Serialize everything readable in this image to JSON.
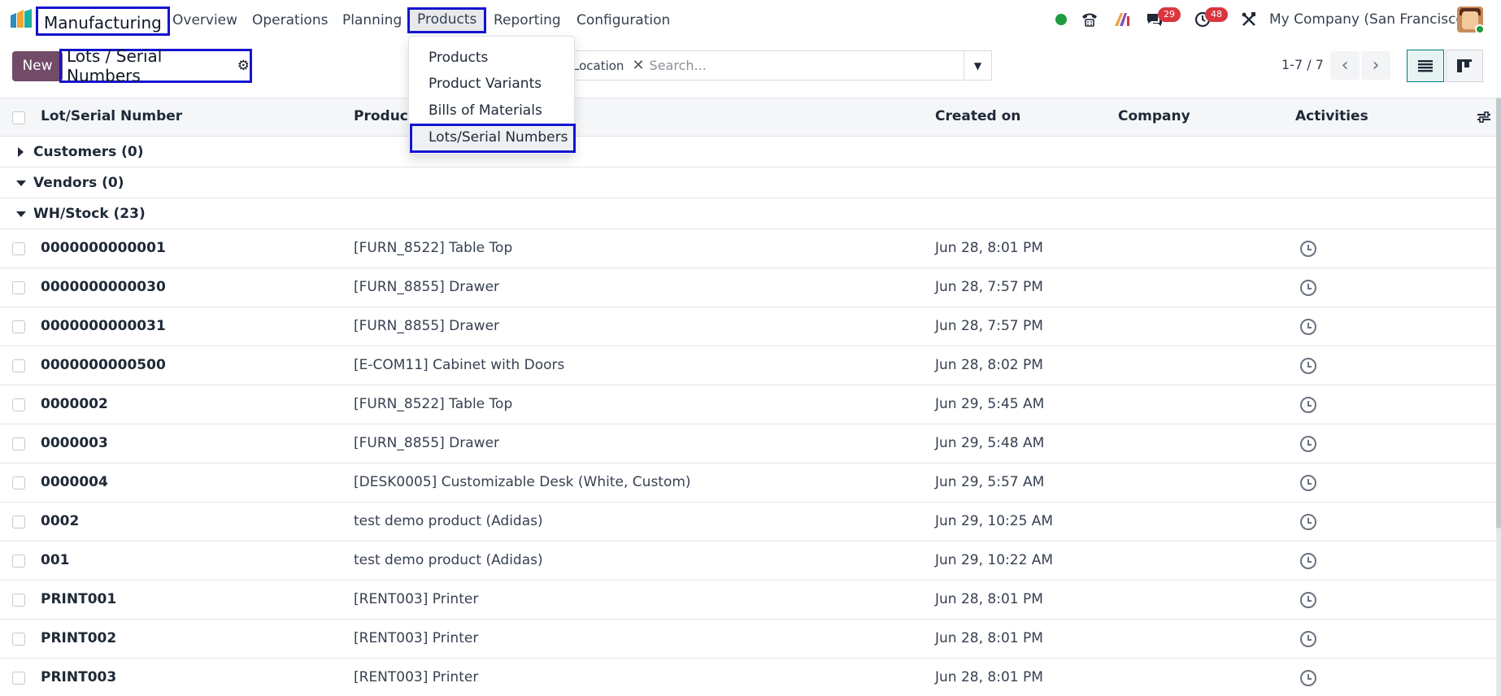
{
  "app": {
    "name": "Manufacturing",
    "nav": [
      "Overview",
      "Operations",
      "Planning",
      "Products",
      "Reporting",
      "Configuration"
    ],
    "active_nav": "Products"
  },
  "systray": {
    "messages_count": "29",
    "activities_count": "48",
    "company": "My Company (San Francisco)"
  },
  "control_panel": {
    "new_label": "New",
    "breadcrumb": "Lots / Serial Numbers",
    "facet_label": "Location",
    "search_placeholder": "Search...",
    "pager": "1-7 / 7"
  },
  "products_menu": {
    "items": [
      "Products",
      "Product Variants",
      "Bills of Materials",
      "Lots/Serial Numbers"
    ],
    "active": "Lots/Serial Numbers"
  },
  "list": {
    "columns": {
      "lot": "Lot/Serial Number",
      "product": "Product",
      "created": "Created on",
      "company": "Company",
      "activities": "Activities"
    },
    "groups": [
      {
        "label": "Customers (0)",
        "expanded": false
      },
      {
        "label": "Vendors (0)",
        "expanded": true
      },
      {
        "label": "WH/Stock (23)",
        "expanded": true
      }
    ],
    "rows": [
      {
        "lot": "0000000000001",
        "product": "[FURN_8522] Table Top",
        "created": "Jun 28, 8:01 PM"
      },
      {
        "lot": "0000000000030",
        "product": "[FURN_8855] Drawer",
        "created": "Jun 28, 7:57 PM"
      },
      {
        "lot": "0000000000031",
        "product": "[FURN_8855] Drawer",
        "created": "Jun 28, 7:57 PM"
      },
      {
        "lot": "0000000000500",
        "product": "[E-COM11] Cabinet with Doors",
        "created": "Jun 28, 8:02 PM"
      },
      {
        "lot": "0000002",
        "product": "[FURN_8522] Table Top",
        "created": "Jun 29, 5:45 AM"
      },
      {
        "lot": "0000003",
        "product": "[FURN_8855] Drawer",
        "created": "Jun 29, 5:48 AM"
      },
      {
        "lot": "0000004",
        "product": "[DESK0005] Customizable Desk (White, Custom)",
        "created": "Jun 29, 5:57 AM"
      },
      {
        "lot": "0002",
        "product": "test demo product (Adidas)",
        "created": "Jun 29, 10:25 AM"
      },
      {
        "lot": "001",
        "product": "test demo product (Adidas)",
        "created": "Jun 29, 10:22 AM"
      },
      {
        "lot": "PRINT001",
        "product": "[RENT003] Printer",
        "created": "Jun 28, 8:01 PM"
      },
      {
        "lot": "PRINT002",
        "product": "[RENT003] Printer",
        "created": "Jun 28, 8:01 PM"
      },
      {
        "lot": "PRINT003",
        "product": "[RENT003] Printer",
        "created": "Jun 28, 8:01 PM"
      }
    ]
  },
  "colors": {
    "brand": "#714b67",
    "highlight_box": "#1414d0",
    "badge": "#d9363e",
    "online": "#1d9c3e"
  }
}
